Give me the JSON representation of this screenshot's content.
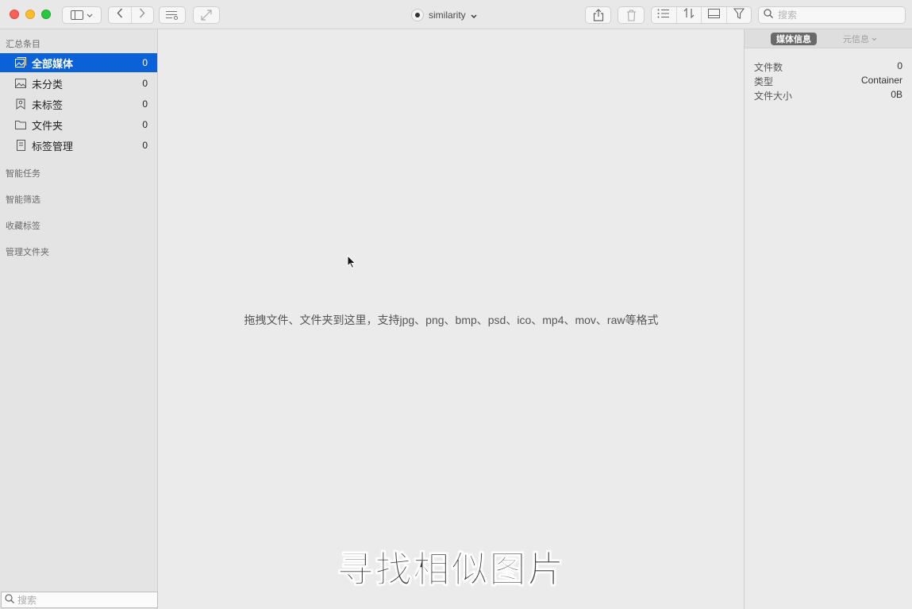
{
  "window": {
    "title": "similarity"
  },
  "toolbar": {
    "search_placeholder": "搜索",
    "icons": [
      "sidebar-toggle-icon",
      "back-icon",
      "forward-icon",
      "edit-list-icon",
      "fullscreen-icon",
      "share-icon",
      "trash-icon",
      "list-view-icon",
      "sort-icon",
      "preview-icon",
      "filter-icon",
      "search-icon"
    ]
  },
  "sidebar": {
    "summary_title": "汇总条目",
    "items": [
      {
        "label": "全部媒体",
        "count": "0",
        "icon": "photo-icon",
        "active": true
      },
      {
        "label": "未分类",
        "count": "0",
        "icon": "image-icon",
        "active": false
      },
      {
        "label": "未标签",
        "count": "0",
        "icon": "tag-icon",
        "active": false
      },
      {
        "label": "文件夹",
        "count": "0",
        "icon": "folder-icon",
        "active": false
      },
      {
        "label": "标签管理",
        "count": "0",
        "icon": "bookmark-icon",
        "active": false
      }
    ],
    "sections": [
      "智能任务",
      "智能筛选",
      "收藏标签",
      "管理文件夹"
    ],
    "search_placeholder": "搜索"
  },
  "main": {
    "drop_hint": "拖拽文件、文件夹到这里，支持jpg、png、bmp、psd、ico、mp4、mov、raw等格式",
    "caption": "寻找相似图片"
  },
  "info_panel": {
    "tab_active": "媒体信息",
    "tab_other": "元信息",
    "rows": [
      {
        "key": "文件数",
        "value": "0"
      },
      {
        "key": "类型",
        "value": "Container"
      },
      {
        "key": "文件大小",
        "value": "0B"
      }
    ]
  },
  "colors": {
    "accent": "#0a61d8",
    "close": "#fc5f57",
    "minimize": "#fdbc2e",
    "zoom": "#29c840"
  }
}
